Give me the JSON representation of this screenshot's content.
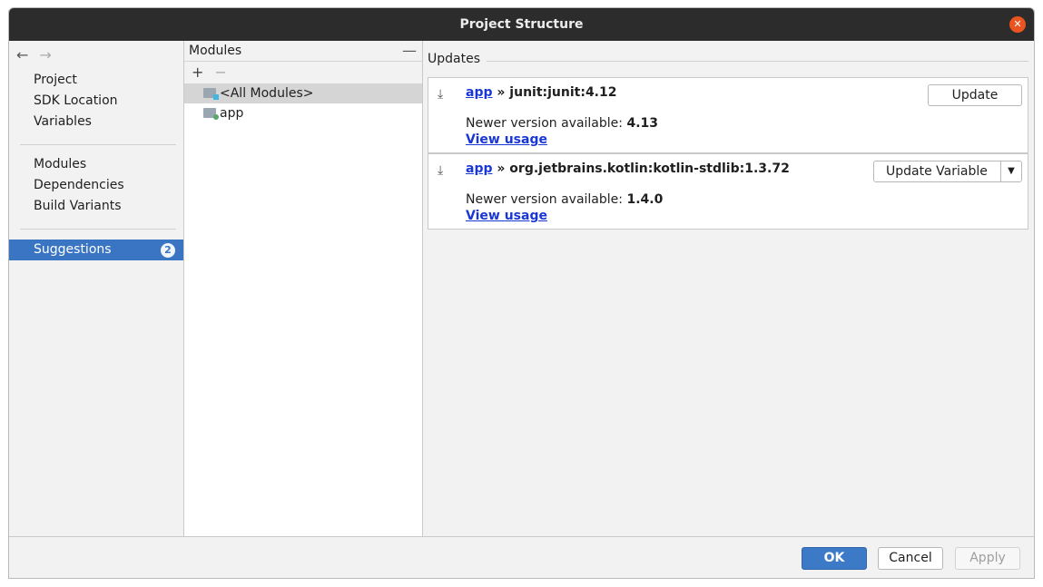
{
  "window": {
    "title": "Project Structure",
    "close_glyph": "✕"
  },
  "nav": {
    "back_glyph": "←",
    "forward_glyph": "→"
  },
  "sidebar": {
    "group1": [
      "Project",
      "SDK Location",
      "Variables"
    ],
    "group2": [
      "Modules",
      "Dependencies",
      "Build Variants"
    ],
    "suggestions": {
      "label": "Suggestions",
      "badge": "2"
    }
  },
  "modules": {
    "header": "Modules",
    "collapse_glyph": "—",
    "add_glyph": "+",
    "remove_glyph": "−",
    "items": [
      "<All Modules>",
      "app"
    ]
  },
  "updates": {
    "title": "Updates",
    "cards": [
      {
        "module": "app",
        "separator": " » ",
        "artifact": "junit:junit:4.12",
        "newer_label": "Newer version available: ",
        "newer_version": "4.13",
        "link": "View usage",
        "button": "Update"
      },
      {
        "module": "app",
        "separator": " » ",
        "artifact": "org.jetbrains.kotlin:kotlin-stdlib:1.3.72",
        "newer_label": "Newer version available: ",
        "newer_version": "1.4.0",
        "link": "View usage",
        "button": "Update Variable"
      }
    ]
  },
  "footer": {
    "ok": "OK",
    "cancel": "Cancel",
    "apply": "Apply"
  },
  "colors": {
    "accent": "#3a75c4",
    "titlebar": "#2c2c2c",
    "close": "#e95420",
    "link": "#1a37d6"
  }
}
